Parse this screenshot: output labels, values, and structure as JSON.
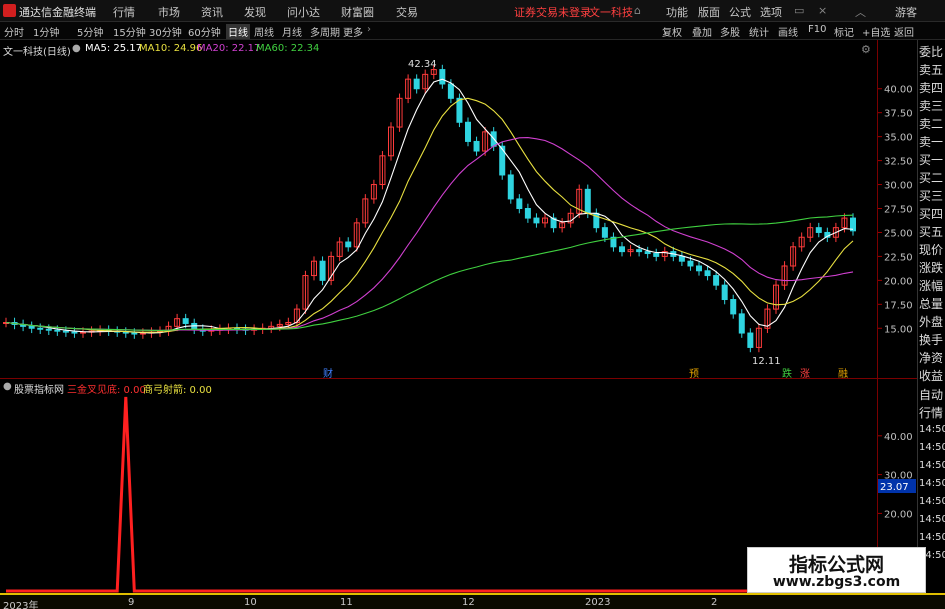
{
  "titlebar": {
    "app_name": "通达信金融终端",
    "menus": [
      "行情",
      "市场",
      "资讯",
      "发现",
      "问小达",
      "财富圈",
      "交易"
    ],
    "notice": "证券交易未登录",
    "stock": "文一科技",
    "right_menus": [
      "功能",
      "版面",
      "公式",
      "选项"
    ],
    "guest": "游客"
  },
  "toolbar": {
    "periods": [
      "分时",
      "1分钟",
      "5分钟",
      "15分钟",
      "30分钟",
      "60分钟",
      "日线",
      "周线",
      "月线",
      "多周期",
      "更多"
    ],
    "active_period": "日线",
    "right_buttons": [
      "复权",
      "叠加",
      "多股",
      "统计",
      "画线",
      "F10",
      "标记",
      "+自选",
      "返回"
    ]
  },
  "main_chart_header": {
    "title": "文一科技(日线)",
    "ma": [
      {
        "label": "MA5: 25.17",
        "color": "#ffffff"
      },
      {
        "label": "MA10: 24.96",
        "color": "#e8e040"
      },
      {
        "label": "MA20: 22.17",
        "color": "#d040d0"
      },
      {
        "label": "MA60: 22.34",
        "color": "#40d040"
      }
    ]
  },
  "sub_chart_header": {
    "title": "股票指标网",
    "ind1": "三金叉见底: 0.00",
    "ind1_color": "#ff3030",
    "ind2": "商弓射箭: 0.00",
    "ind2_color": "#e8e040"
  },
  "annotations": {
    "high": "42.34",
    "low": "12.11",
    "markers": [
      {
        "text": "财",
        "color": "#4080ff"
      },
      {
        "text": "预",
        "color": "#e0a000"
      },
      {
        "text": "跌",
        "color": "#40d040"
      },
      {
        "text": "涨",
        "color": "#ff4040"
      },
      {
        "text": "融",
        "color": "#e0a000"
      }
    ]
  },
  "chart_data": [
    {
      "type": "candlestick",
      "title": "文一科技(日线)",
      "ylim": [
        12,
        43
      ],
      "y_ticks": [
        "40.00",
        "37.50",
        "35.00",
        "32.50",
        "30.00",
        "27.50",
        "25.00",
        "22.50",
        "20.00",
        "17.50",
        "15.00"
      ],
      "high": 42.34,
      "low": 12.11,
      "series": [
        {
          "name": "MA5",
          "last": 25.17
        },
        {
          "name": "MA10",
          "last": 24.96
        },
        {
          "name": "MA20",
          "last": 22.17
        },
        {
          "name": "MA60",
          "last": 22.34
        }
      ],
      "closes": [
        15.6,
        15.4,
        15.2,
        15.0,
        14.9,
        14.8,
        14.7,
        14.6,
        14.5,
        14.6,
        14.7,
        14.8,
        14.7,
        14.6,
        14.5,
        14.4,
        14.5,
        14.6,
        14.7,
        15.2,
        16.0,
        15.5,
        14.9,
        14.7,
        14.8,
        14.9,
        15.0,
        14.9,
        14.8,
        14.9,
        15.0,
        15.2,
        15.4,
        15.6,
        17.0,
        20.5,
        22.0,
        20.0,
        22.5,
        24.0,
        23.5,
        26.0,
        28.5,
        30.0,
        33.0,
        36.0,
        39.0,
        41.0,
        40.0,
        41.5,
        42.0,
        40.5,
        39.0,
        36.5,
        34.5,
        33.5,
        35.5,
        34.0,
        31.0,
        28.5,
        27.5,
        26.5,
        26.0,
        26.5,
        25.5,
        26.0,
        27.0,
        29.5,
        27.0,
        25.5,
        24.5,
        23.5,
        23.0,
        23.2,
        23.0,
        22.8,
        22.5,
        23.0,
        22.5,
        22.0,
        21.5,
        21.0,
        20.5,
        19.5,
        18.0,
        16.5,
        14.5,
        13.0,
        15.0,
        17.0,
        19.5,
        21.5,
        23.5,
        24.5,
        25.5,
        25.0,
        24.5,
        25.5,
        26.5,
        25.17
      ]
    },
    {
      "type": "line",
      "title": "股票指标网",
      "ylim": [
        0,
        50
      ],
      "y_ticks": [
        "40.00",
        "30.00",
        "20.00"
      ],
      "highlight": "23.07",
      "series": [
        {
          "name": "三金叉见底",
          "values": [
            0,
            0,
            0,
            0,
            0,
            0,
            0,
            0,
            0,
            0,
            0,
            0,
            0,
            0,
            50,
            0,
            0,
            0,
            0,
            0,
            0,
            0,
            0,
            0,
            0,
            0,
            0,
            0,
            0,
            0,
            0,
            0,
            0,
            0,
            0,
            0,
            0,
            0,
            0,
            0,
            0,
            0,
            0,
            0,
            0,
            0,
            0,
            0,
            0,
            0,
            0,
            0,
            0,
            0,
            0,
            0,
            0,
            0,
            0,
            0,
            0,
            0,
            0,
            0,
            0,
            0,
            0,
            0,
            0,
            0,
            0,
            0,
            0,
            0,
            0,
            0,
            0,
            0,
            0,
            0,
            0,
            0,
            0,
            0,
            0,
            0,
            0,
            0,
            0,
            0,
            0,
            0,
            0,
            0,
            0,
            0,
            0,
            0,
            0,
            0
          ]
        },
        {
          "name": "商弓射箭",
          "values": []
        }
      ]
    }
  ],
  "time_axis": [
    "2023年",
    "9",
    "10",
    "11",
    "12",
    "2023",
    "2"
  ],
  "sidebar": [
    "委比",
    "卖五",
    "卖四",
    "卖三",
    "卖二",
    "卖一",
    "买一",
    "买二",
    "买三",
    "买四",
    "买五",
    "现价",
    "涨跌",
    "涨幅",
    "总量",
    "外盘",
    "换手",
    "净资",
    "收益",
    "自动",
    "行情",
    "14:50",
    "14:50",
    "14:50",
    "14:50",
    "14:50",
    "14:50",
    "14:50",
    "14:50"
  ],
  "watermark": {
    "line1": "指标公式网",
    "line2": "www.zbgs3.com"
  }
}
